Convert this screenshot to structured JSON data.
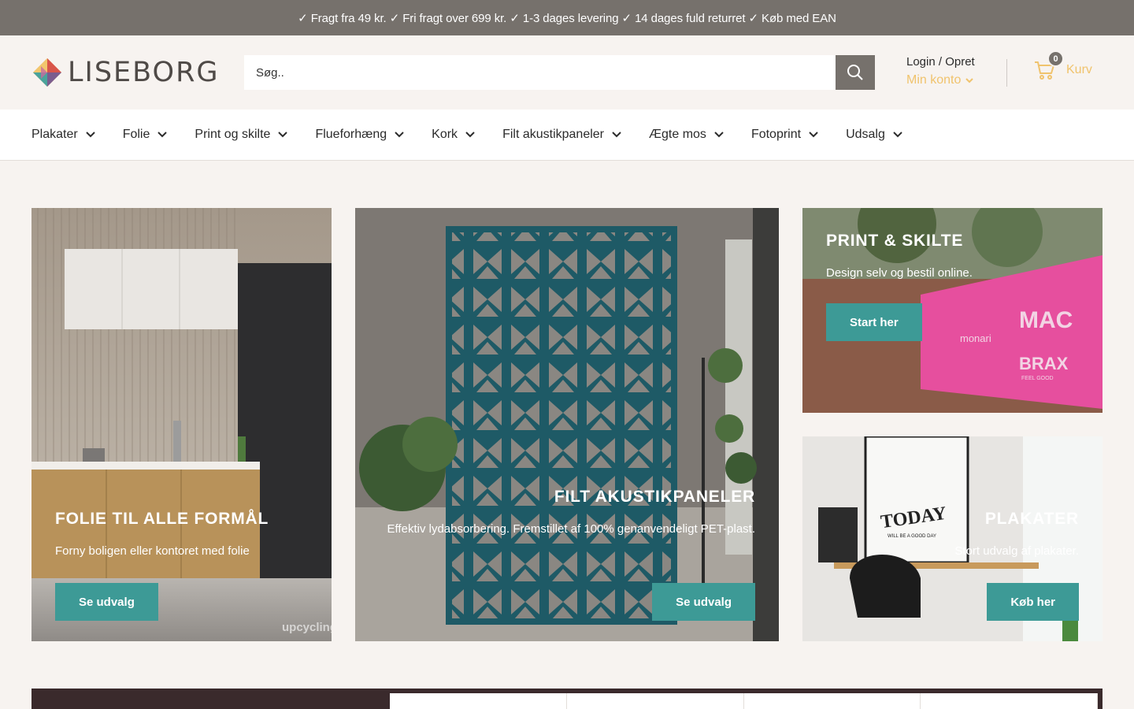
{
  "announcement": "✓ Fragt fra 49 kr. ✓ Fri fragt over 699 kr. ✓ 1-3 dages levering ✓ 14 dages fuld returret ✓ Køb med EAN",
  "brand": {
    "name": "LISEBORG"
  },
  "search": {
    "placeholder": "Søg.."
  },
  "account": {
    "login_label": "Login / Opret",
    "account_label": "Min konto"
  },
  "cart": {
    "count": "0",
    "label": "Kurv"
  },
  "nav": [
    {
      "label": "Plakater"
    },
    {
      "label": "Folie"
    },
    {
      "label": "Print og skilte"
    },
    {
      "label": "Flueforhæng"
    },
    {
      "label": "Kork"
    },
    {
      "label": "Filt akustikpaneler"
    },
    {
      "label": "Ægte mos"
    },
    {
      "label": "Fotoprint"
    },
    {
      "label": "Udsalg"
    }
  ],
  "promos": {
    "folie": {
      "title": "FOLIE TIL ALLE FORMÅL",
      "subtitle": "Forny boligen eller kontoret med folie",
      "button": "Se udvalg",
      "watermark": "upcycling"
    },
    "filt": {
      "title": "FILT AKUSTIKPANELER",
      "subtitle": "Effektiv lydabsorbering. Fremstillet af 100% genanvendeligt PET-plast.",
      "button": "Se udvalg"
    },
    "print": {
      "title": "PRINT & SKILTE",
      "subtitle": "Design selv og bestil online.",
      "button": "Start her",
      "sign_text_1": "MAC",
      "sign_text_2": "monari",
      "sign_text_3": "BRAX",
      "sign_text_4": "FEEL GOOD"
    },
    "plakater": {
      "title": "PLAKATER",
      "subtitle": "Stort udvalg af plakater.",
      "button": "Køb her",
      "poster_text": "TODAY",
      "poster_sub": "WILL BE A GOOD DAY"
    }
  },
  "colors": {
    "accent": "#3d9a96",
    "topbar": "#76716c",
    "gold": "#f0c36d",
    "background": "#f7f3f0"
  }
}
